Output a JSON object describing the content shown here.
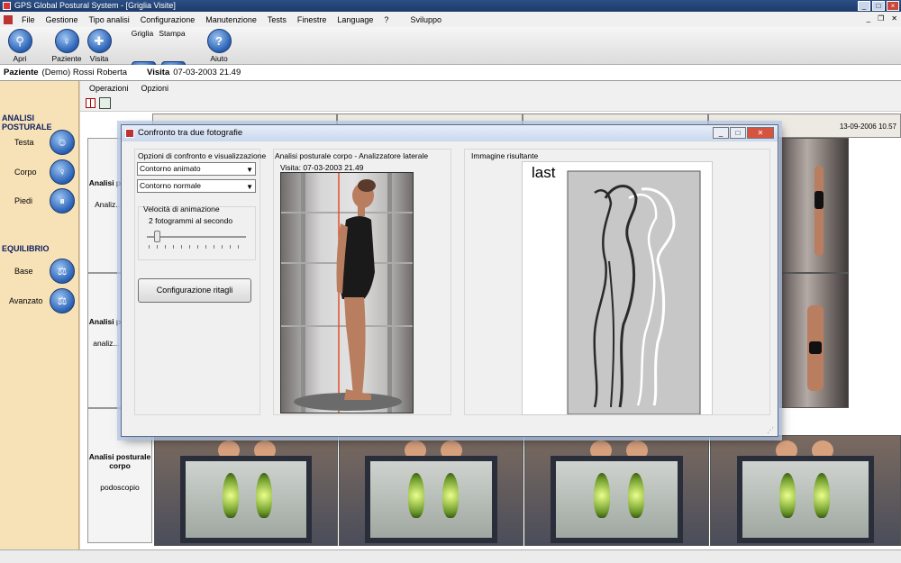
{
  "window": {
    "title": "GPS Global Postural System - [Griglia Visite]"
  },
  "menu": [
    "File",
    "Gestione",
    "Tipo analisi",
    "Configurazione",
    "Manutenzione",
    "Tests",
    "Finestre",
    "Language",
    "?",
    "Sviluppo"
  ],
  "toolbar": {
    "apri": "Apri",
    "paziente": "Paziente",
    "visita": "Visita",
    "griglia": "Griglia",
    "stampa": "Stampa",
    "aiuto": "Aiuto"
  },
  "patient": {
    "label": "Paziente",
    "name": "(Demo) Rossi Roberta",
    "visit_label": "Visita",
    "visit_date": "07-03-2003 21.49"
  },
  "sidebar": {
    "section1": "ANALISI POSTURALE",
    "items1": [
      "Testa",
      "Corpo",
      "Piedi"
    ],
    "section2": "EQUILIBRIO",
    "items2": [
      "Base",
      "Avanzato"
    ]
  },
  "child": {
    "menu": [
      "Operazioni",
      "Opzioni"
    ],
    "col_header_last": "13-09-2006 10.57",
    "rows": [
      {
        "title": "Analisi p... corpo",
        "sub": "Analiz... later..."
      },
      {
        "title": "Analisi p... corpo",
        "sub": "analiz... poste..."
      },
      {
        "title": "Analisi posturale corpo",
        "sub": "podoscopio"
      }
    ]
  },
  "dialog": {
    "title": "Confronto tra due fotografie",
    "options_title": "Opzioni di confronto e visualizzazione",
    "combo1": "Contorno animato",
    "combo2": "Contorno normale",
    "speed_title": "Velocità di animazione",
    "speed_value": "2 fotogrammi al secondo",
    "slider_level": 0.1,
    "config_button": "Configurazione ritagli",
    "mid_title": "Analisi posturale corpo - Analizzatore laterale",
    "visit_caption": "Visita: 07-03-2003 21.49",
    "right_title": "Immagine risultante",
    "result_label": "last"
  }
}
